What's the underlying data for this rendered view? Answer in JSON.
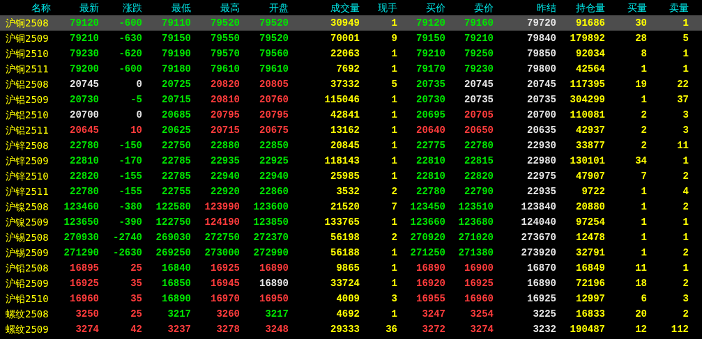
{
  "columns": [
    "名称",
    "最新",
    "涨跌",
    "最低",
    "最高",
    "开盘",
    "成交量",
    "现手",
    "买价",
    "卖价",
    "昨结",
    "持仓量",
    "买量",
    "卖量"
  ],
  "rows": [
    {
      "selected": true,
      "cells": [
        {
          "text": "沪铜2508",
          "color": "#ffff00"
        },
        {
          "text": "79120",
          "color": "#00e600"
        },
        {
          "text": "-600",
          "color": "#00e600"
        },
        {
          "text": "79110",
          "color": "#00e600"
        },
        {
          "text": "79520",
          "color": "#00e600"
        },
        {
          "text": "79520",
          "color": "#00e600"
        },
        {
          "text": "30949",
          "color": "#ffff00"
        },
        {
          "text": "1",
          "color": "#ffff00"
        },
        {
          "text": "79120",
          "color": "#00e600"
        },
        {
          "text": "79160",
          "color": "#00e600"
        },
        {
          "text": "79720",
          "color": "#e6e6e6"
        },
        {
          "text": "91686",
          "color": "#ffff00"
        },
        {
          "text": "30",
          "color": "#ffff00"
        },
        {
          "text": "1",
          "color": "#ffff00"
        }
      ]
    },
    {
      "selected": false,
      "cells": [
        {
          "text": "沪铜2509",
          "color": "#ffff00"
        },
        {
          "text": "79210",
          "color": "#00e600"
        },
        {
          "text": "-630",
          "color": "#00e600"
        },
        {
          "text": "79150",
          "color": "#00e600"
        },
        {
          "text": "79550",
          "color": "#00e600"
        },
        {
          "text": "79520",
          "color": "#00e600"
        },
        {
          "text": "70001",
          "color": "#ffff00"
        },
        {
          "text": "9",
          "color": "#ffff00"
        },
        {
          "text": "79150",
          "color": "#00e600"
        },
        {
          "text": "79210",
          "color": "#00e600"
        },
        {
          "text": "79840",
          "color": "#e6e6e6"
        },
        {
          "text": "179892",
          "color": "#ffff00"
        },
        {
          "text": "28",
          "color": "#ffff00"
        },
        {
          "text": "5",
          "color": "#ffff00"
        }
      ]
    },
    {
      "selected": false,
      "cells": [
        {
          "text": "沪铜2510",
          "color": "#ffff00"
        },
        {
          "text": "79230",
          "color": "#00e600"
        },
        {
          "text": "-620",
          "color": "#00e600"
        },
        {
          "text": "79190",
          "color": "#00e600"
        },
        {
          "text": "79570",
          "color": "#00e600"
        },
        {
          "text": "79560",
          "color": "#00e600"
        },
        {
          "text": "22063",
          "color": "#ffff00"
        },
        {
          "text": "1",
          "color": "#ffff00"
        },
        {
          "text": "79210",
          "color": "#00e600"
        },
        {
          "text": "79250",
          "color": "#00e600"
        },
        {
          "text": "79850",
          "color": "#e6e6e6"
        },
        {
          "text": "92034",
          "color": "#ffff00"
        },
        {
          "text": "8",
          "color": "#ffff00"
        },
        {
          "text": "1",
          "color": "#ffff00"
        }
      ]
    },
    {
      "selected": false,
      "cells": [
        {
          "text": "沪铜2511",
          "color": "#ffff00"
        },
        {
          "text": "79200",
          "color": "#00e600"
        },
        {
          "text": "-600",
          "color": "#00e600"
        },
        {
          "text": "79180",
          "color": "#00e600"
        },
        {
          "text": "79610",
          "color": "#00e600"
        },
        {
          "text": "79610",
          "color": "#00e600"
        },
        {
          "text": "7692",
          "color": "#ffff00"
        },
        {
          "text": "1",
          "color": "#ffff00"
        },
        {
          "text": "79170",
          "color": "#00e600"
        },
        {
          "text": "79230",
          "color": "#00e600"
        },
        {
          "text": "79800",
          "color": "#e6e6e6"
        },
        {
          "text": "42564",
          "color": "#ffff00"
        },
        {
          "text": "1",
          "color": "#ffff00"
        },
        {
          "text": "1",
          "color": "#ffff00"
        }
      ]
    },
    {
      "selected": false,
      "cells": [
        {
          "text": "沪铝2508",
          "color": "#ffff00"
        },
        {
          "text": "20745",
          "color": "#e6e6e6"
        },
        {
          "text": "0",
          "color": "#e6e6e6"
        },
        {
          "text": "20725",
          "color": "#00e600"
        },
        {
          "text": "20820",
          "color": "#ff3c3c"
        },
        {
          "text": "20805",
          "color": "#ff3c3c"
        },
        {
          "text": "37332",
          "color": "#ffff00"
        },
        {
          "text": "5",
          "color": "#ffff00"
        },
        {
          "text": "20735",
          "color": "#00e600"
        },
        {
          "text": "20745",
          "color": "#e6e6e6"
        },
        {
          "text": "20745",
          "color": "#e6e6e6"
        },
        {
          "text": "117395",
          "color": "#ffff00"
        },
        {
          "text": "19",
          "color": "#ffff00"
        },
        {
          "text": "22",
          "color": "#ffff00"
        }
      ]
    },
    {
      "selected": false,
      "cells": [
        {
          "text": "沪铝2509",
          "color": "#ffff00"
        },
        {
          "text": "20730",
          "color": "#00e600"
        },
        {
          "text": "-5",
          "color": "#00e600"
        },
        {
          "text": "20715",
          "color": "#00e600"
        },
        {
          "text": "20810",
          "color": "#ff3c3c"
        },
        {
          "text": "20760",
          "color": "#ff3c3c"
        },
        {
          "text": "115046",
          "color": "#ffff00"
        },
        {
          "text": "1",
          "color": "#ffff00"
        },
        {
          "text": "20730",
          "color": "#00e600"
        },
        {
          "text": "20735",
          "color": "#e6e6e6"
        },
        {
          "text": "20735",
          "color": "#e6e6e6"
        },
        {
          "text": "304299",
          "color": "#ffff00"
        },
        {
          "text": "1",
          "color": "#ffff00"
        },
        {
          "text": "37",
          "color": "#ffff00"
        }
      ]
    },
    {
      "selected": false,
      "cells": [
        {
          "text": "沪铝2510",
          "color": "#ffff00"
        },
        {
          "text": "20700",
          "color": "#e6e6e6"
        },
        {
          "text": "0",
          "color": "#e6e6e6"
        },
        {
          "text": "20685",
          "color": "#00e600"
        },
        {
          "text": "20795",
          "color": "#ff3c3c"
        },
        {
          "text": "20795",
          "color": "#ff3c3c"
        },
        {
          "text": "42841",
          "color": "#ffff00"
        },
        {
          "text": "1",
          "color": "#ffff00"
        },
        {
          "text": "20695",
          "color": "#00e600"
        },
        {
          "text": "20705",
          "color": "#ff3c3c"
        },
        {
          "text": "20700",
          "color": "#e6e6e6"
        },
        {
          "text": "110081",
          "color": "#ffff00"
        },
        {
          "text": "2",
          "color": "#ffff00"
        },
        {
          "text": "3",
          "color": "#ffff00"
        }
      ]
    },
    {
      "selected": false,
      "cells": [
        {
          "text": "沪铝2511",
          "color": "#ffff00"
        },
        {
          "text": "20645",
          "color": "#ff3c3c"
        },
        {
          "text": "10",
          "color": "#ff3c3c"
        },
        {
          "text": "20625",
          "color": "#00e600"
        },
        {
          "text": "20715",
          "color": "#ff3c3c"
        },
        {
          "text": "20675",
          "color": "#ff3c3c"
        },
        {
          "text": "13162",
          "color": "#ffff00"
        },
        {
          "text": "1",
          "color": "#ffff00"
        },
        {
          "text": "20640",
          "color": "#ff3c3c"
        },
        {
          "text": "20650",
          "color": "#ff3c3c"
        },
        {
          "text": "20635",
          "color": "#e6e6e6"
        },
        {
          "text": "42937",
          "color": "#ffff00"
        },
        {
          "text": "2",
          "color": "#ffff00"
        },
        {
          "text": "3",
          "color": "#ffff00"
        }
      ]
    },
    {
      "selected": false,
      "cells": [
        {
          "text": "沪锌2508",
          "color": "#ffff00"
        },
        {
          "text": "22780",
          "color": "#00e600"
        },
        {
          "text": "-150",
          "color": "#00e600"
        },
        {
          "text": "22750",
          "color": "#00e600"
        },
        {
          "text": "22880",
          "color": "#00e600"
        },
        {
          "text": "22850",
          "color": "#00e600"
        },
        {
          "text": "20845",
          "color": "#ffff00"
        },
        {
          "text": "1",
          "color": "#ffff00"
        },
        {
          "text": "22775",
          "color": "#00e600"
        },
        {
          "text": "22780",
          "color": "#00e600"
        },
        {
          "text": "22930",
          "color": "#e6e6e6"
        },
        {
          "text": "33877",
          "color": "#ffff00"
        },
        {
          "text": "2",
          "color": "#ffff00"
        },
        {
          "text": "11",
          "color": "#ffff00"
        }
      ]
    },
    {
      "selected": false,
      "cells": [
        {
          "text": "沪锌2509",
          "color": "#ffff00"
        },
        {
          "text": "22810",
          "color": "#00e600"
        },
        {
          "text": "-170",
          "color": "#00e600"
        },
        {
          "text": "22785",
          "color": "#00e600"
        },
        {
          "text": "22935",
          "color": "#00e600"
        },
        {
          "text": "22925",
          "color": "#00e600"
        },
        {
          "text": "118143",
          "color": "#ffff00"
        },
        {
          "text": "1",
          "color": "#ffff00"
        },
        {
          "text": "22810",
          "color": "#00e600"
        },
        {
          "text": "22815",
          "color": "#00e600"
        },
        {
          "text": "22980",
          "color": "#e6e6e6"
        },
        {
          "text": "130101",
          "color": "#ffff00"
        },
        {
          "text": "34",
          "color": "#ffff00"
        },
        {
          "text": "1",
          "color": "#ffff00"
        }
      ]
    },
    {
      "selected": false,
      "cells": [
        {
          "text": "沪锌2510",
          "color": "#ffff00"
        },
        {
          "text": "22820",
          "color": "#00e600"
        },
        {
          "text": "-155",
          "color": "#00e600"
        },
        {
          "text": "22785",
          "color": "#00e600"
        },
        {
          "text": "22940",
          "color": "#00e600"
        },
        {
          "text": "22940",
          "color": "#00e600"
        },
        {
          "text": "25985",
          "color": "#ffff00"
        },
        {
          "text": "1",
          "color": "#ffff00"
        },
        {
          "text": "22810",
          "color": "#00e600"
        },
        {
          "text": "22820",
          "color": "#00e600"
        },
        {
          "text": "22975",
          "color": "#e6e6e6"
        },
        {
          "text": "47907",
          "color": "#ffff00"
        },
        {
          "text": "7",
          "color": "#ffff00"
        },
        {
          "text": "2",
          "color": "#ffff00"
        }
      ]
    },
    {
      "selected": false,
      "cells": [
        {
          "text": "沪锌2511",
          "color": "#ffff00"
        },
        {
          "text": "22780",
          "color": "#00e600"
        },
        {
          "text": "-155",
          "color": "#00e600"
        },
        {
          "text": "22755",
          "color": "#00e600"
        },
        {
          "text": "22920",
          "color": "#00e600"
        },
        {
          "text": "22860",
          "color": "#00e600"
        },
        {
          "text": "3532",
          "color": "#ffff00"
        },
        {
          "text": "2",
          "color": "#ffff00"
        },
        {
          "text": "22780",
          "color": "#00e600"
        },
        {
          "text": "22790",
          "color": "#00e600"
        },
        {
          "text": "22935",
          "color": "#e6e6e6"
        },
        {
          "text": "9722",
          "color": "#ffff00"
        },
        {
          "text": "1",
          "color": "#ffff00"
        },
        {
          "text": "4",
          "color": "#ffff00"
        }
      ]
    },
    {
      "selected": false,
      "cells": [
        {
          "text": "沪镍2508",
          "color": "#ffff00"
        },
        {
          "text": "123460",
          "color": "#00e600"
        },
        {
          "text": "-380",
          "color": "#00e600"
        },
        {
          "text": "122580",
          "color": "#00e600"
        },
        {
          "text": "123990",
          "color": "#ff3c3c"
        },
        {
          "text": "123600",
          "color": "#00e600"
        },
        {
          "text": "21520",
          "color": "#ffff00"
        },
        {
          "text": "7",
          "color": "#ffff00"
        },
        {
          "text": "123450",
          "color": "#00e600"
        },
        {
          "text": "123510",
          "color": "#00e600"
        },
        {
          "text": "123840",
          "color": "#e6e6e6"
        },
        {
          "text": "20880",
          "color": "#ffff00"
        },
        {
          "text": "1",
          "color": "#ffff00"
        },
        {
          "text": "2",
          "color": "#ffff00"
        }
      ]
    },
    {
      "selected": false,
      "cells": [
        {
          "text": "沪镍2509",
          "color": "#ffff00"
        },
        {
          "text": "123650",
          "color": "#00e600"
        },
        {
          "text": "-390",
          "color": "#00e600"
        },
        {
          "text": "122750",
          "color": "#00e600"
        },
        {
          "text": "124190",
          "color": "#ff3c3c"
        },
        {
          "text": "123850",
          "color": "#00e600"
        },
        {
          "text": "133765",
          "color": "#ffff00"
        },
        {
          "text": "1",
          "color": "#ffff00"
        },
        {
          "text": "123660",
          "color": "#00e600"
        },
        {
          "text": "123680",
          "color": "#00e600"
        },
        {
          "text": "124040",
          "color": "#e6e6e6"
        },
        {
          "text": "97254",
          "color": "#ffff00"
        },
        {
          "text": "1",
          "color": "#ffff00"
        },
        {
          "text": "1",
          "color": "#ffff00"
        }
      ]
    },
    {
      "selected": false,
      "cells": [
        {
          "text": "沪锡2508",
          "color": "#ffff00"
        },
        {
          "text": "270930",
          "color": "#00e600"
        },
        {
          "text": "-2740",
          "color": "#00e600"
        },
        {
          "text": "269030",
          "color": "#00e600"
        },
        {
          "text": "272750",
          "color": "#00e600"
        },
        {
          "text": "272370",
          "color": "#00e600"
        },
        {
          "text": "56198",
          "color": "#ffff00"
        },
        {
          "text": "2",
          "color": "#ffff00"
        },
        {
          "text": "270920",
          "color": "#00e600"
        },
        {
          "text": "271020",
          "color": "#00e600"
        },
        {
          "text": "273670",
          "color": "#e6e6e6"
        },
        {
          "text": "12478",
          "color": "#ffff00"
        },
        {
          "text": "1",
          "color": "#ffff00"
        },
        {
          "text": "1",
          "color": "#ffff00"
        }
      ]
    },
    {
      "selected": false,
      "cells": [
        {
          "text": "沪锡2509",
          "color": "#ffff00"
        },
        {
          "text": "271290",
          "color": "#00e600"
        },
        {
          "text": "-2630",
          "color": "#00e600"
        },
        {
          "text": "269250",
          "color": "#00e600"
        },
        {
          "text": "273000",
          "color": "#00e600"
        },
        {
          "text": "272990",
          "color": "#00e600"
        },
        {
          "text": "56188",
          "color": "#ffff00"
        },
        {
          "text": "1",
          "color": "#ffff00"
        },
        {
          "text": "271250",
          "color": "#00e600"
        },
        {
          "text": "271380",
          "color": "#00e600"
        },
        {
          "text": "273920",
          "color": "#e6e6e6"
        },
        {
          "text": "32791",
          "color": "#ffff00"
        },
        {
          "text": "1",
          "color": "#ffff00"
        },
        {
          "text": "2",
          "color": "#ffff00"
        }
      ]
    },
    {
      "selected": false,
      "cells": [
        {
          "text": "沪铅2508",
          "color": "#ffff00"
        },
        {
          "text": "16895",
          "color": "#ff3c3c"
        },
        {
          "text": "25",
          "color": "#ff3c3c"
        },
        {
          "text": "16840",
          "color": "#00e600"
        },
        {
          "text": "16925",
          "color": "#ff3c3c"
        },
        {
          "text": "16890",
          "color": "#ff3c3c"
        },
        {
          "text": "9865",
          "color": "#ffff00"
        },
        {
          "text": "1",
          "color": "#ffff00"
        },
        {
          "text": "16890",
          "color": "#ff3c3c"
        },
        {
          "text": "16900",
          "color": "#ff3c3c"
        },
        {
          "text": "16870",
          "color": "#e6e6e6"
        },
        {
          "text": "16849",
          "color": "#ffff00"
        },
        {
          "text": "11",
          "color": "#ffff00"
        },
        {
          "text": "1",
          "color": "#ffff00"
        }
      ]
    },
    {
      "selected": false,
      "cells": [
        {
          "text": "沪铅2509",
          "color": "#ffff00"
        },
        {
          "text": "16925",
          "color": "#ff3c3c"
        },
        {
          "text": "35",
          "color": "#ff3c3c"
        },
        {
          "text": "16850",
          "color": "#00e600"
        },
        {
          "text": "16945",
          "color": "#ff3c3c"
        },
        {
          "text": "16890",
          "color": "#e6e6e6"
        },
        {
          "text": "33724",
          "color": "#ffff00"
        },
        {
          "text": "1",
          "color": "#ffff00"
        },
        {
          "text": "16920",
          "color": "#ff3c3c"
        },
        {
          "text": "16925",
          "color": "#ff3c3c"
        },
        {
          "text": "16890",
          "color": "#e6e6e6"
        },
        {
          "text": "72196",
          "color": "#ffff00"
        },
        {
          "text": "18",
          "color": "#ffff00"
        },
        {
          "text": "2",
          "color": "#ffff00"
        }
      ]
    },
    {
      "selected": false,
      "cells": [
        {
          "text": "沪铅2510",
          "color": "#ffff00"
        },
        {
          "text": "16960",
          "color": "#ff3c3c"
        },
        {
          "text": "35",
          "color": "#ff3c3c"
        },
        {
          "text": "16890",
          "color": "#00e600"
        },
        {
          "text": "16970",
          "color": "#ff3c3c"
        },
        {
          "text": "16950",
          "color": "#ff3c3c"
        },
        {
          "text": "4009",
          "color": "#ffff00"
        },
        {
          "text": "3",
          "color": "#ffff00"
        },
        {
          "text": "16955",
          "color": "#ff3c3c"
        },
        {
          "text": "16960",
          "color": "#ff3c3c"
        },
        {
          "text": "16925",
          "color": "#e6e6e6"
        },
        {
          "text": "12997",
          "color": "#ffff00"
        },
        {
          "text": "6",
          "color": "#ffff00"
        },
        {
          "text": "3",
          "color": "#ffff00"
        }
      ]
    },
    {
      "selected": false,
      "cells": [
        {
          "text": "螺纹2508",
          "color": "#ffff00"
        },
        {
          "text": "3250",
          "color": "#ff3c3c"
        },
        {
          "text": "25",
          "color": "#ff3c3c"
        },
        {
          "text": "3217",
          "color": "#00e600"
        },
        {
          "text": "3260",
          "color": "#ff3c3c"
        },
        {
          "text": "3217",
          "color": "#00e600"
        },
        {
          "text": "4692",
          "color": "#ffff00"
        },
        {
          "text": "1",
          "color": "#ffff00"
        },
        {
          "text": "3247",
          "color": "#ff3c3c"
        },
        {
          "text": "3254",
          "color": "#ff3c3c"
        },
        {
          "text": "3225",
          "color": "#e6e6e6"
        },
        {
          "text": "16833",
          "color": "#ffff00"
        },
        {
          "text": "20",
          "color": "#ffff00"
        },
        {
          "text": "2",
          "color": "#ffff00"
        }
      ]
    },
    {
      "selected": false,
      "cells": [
        {
          "text": "螺纹2509",
          "color": "#ffff00"
        },
        {
          "text": "3274",
          "color": "#ff3c3c"
        },
        {
          "text": "42",
          "color": "#ff3c3c"
        },
        {
          "text": "3237",
          "color": "#ff3c3c"
        },
        {
          "text": "3278",
          "color": "#ff3c3c"
        },
        {
          "text": "3248",
          "color": "#ff3c3c"
        },
        {
          "text": "29333",
          "color": "#ffff00"
        },
        {
          "text": "36",
          "color": "#ffff00"
        },
        {
          "text": "3272",
          "color": "#ff3c3c"
        },
        {
          "text": "3274",
          "color": "#ff3c3c"
        },
        {
          "text": "3232",
          "color": "#e6e6e6"
        },
        {
          "text": "190487",
          "color": "#ffff00"
        },
        {
          "text": "12",
          "color": "#ffff00"
        },
        {
          "text": "112",
          "color": "#ffff00"
        }
      ]
    }
  ]
}
